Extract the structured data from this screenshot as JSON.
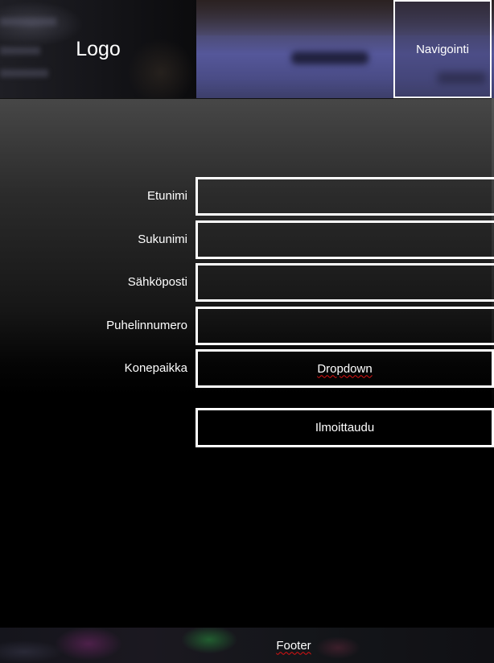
{
  "header": {
    "logo_text": "Logo",
    "nav_label": "Navigointi"
  },
  "form": {
    "fields": [
      {
        "label": "Etunimi",
        "value": ""
      },
      {
        "label": "Sukunimi",
        "value": ""
      },
      {
        "label": "Sähköposti",
        "value": ""
      },
      {
        "label": "Puhelinnumero",
        "value": ""
      }
    ],
    "dropdown": {
      "label": "Konepaikka",
      "selected": "Dropdown"
    },
    "submit_label": "Ilmoittaudu"
  },
  "footer": {
    "text": "Footer"
  },
  "colors": {
    "background": "#000000",
    "text": "#ffffff",
    "border": "#ffffff",
    "spellcheck_underline": "#dd1111"
  }
}
